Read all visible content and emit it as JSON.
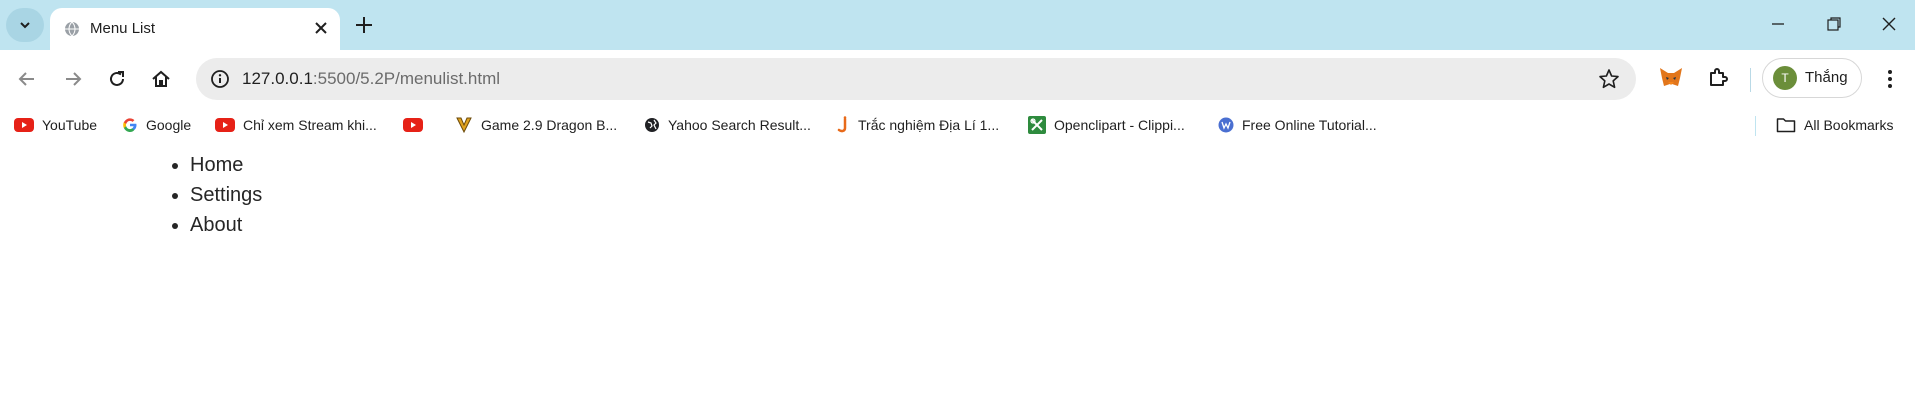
{
  "browser": {
    "tab_title": "Menu List",
    "url_host": "127.0.0.1",
    "url_rest": ":5500/5.2P/menulist.html",
    "profile_initial": "T",
    "profile_name": "Thắng",
    "all_bookmarks_label": "All Bookmarks",
    "bookmarks": [
      {
        "label": "YouTube",
        "icon": "youtube-icon"
      },
      {
        "label": "Google",
        "icon": "google-icon"
      },
      {
        "label": "Chỉ xem Stream khi...",
        "icon": "youtube-icon"
      },
      {
        "label": "",
        "icon": "youtube-icon"
      },
      {
        "label": "Game 2.9 Dragon B...",
        "icon": "v-logo-icon"
      },
      {
        "label": "Yahoo Search Result...",
        "icon": "globe-icon"
      },
      {
        "label": "Trắc nghiệm Địa Lí 1...",
        "icon": "j-logo-icon"
      },
      {
        "label": "Openclipart - Clippi...",
        "icon": "openclipart-icon"
      },
      {
        "label": "Free Online Tutorial...",
        "icon": "w-logo-icon"
      }
    ]
  },
  "page": {
    "menu_items": [
      "Home",
      "Settings",
      "About"
    ]
  },
  "colors": {
    "titlebar": "#bfe4f0",
    "omnibox": "#ececec",
    "avatar": "#6b8e3a",
    "youtube_red": "#e62117"
  }
}
